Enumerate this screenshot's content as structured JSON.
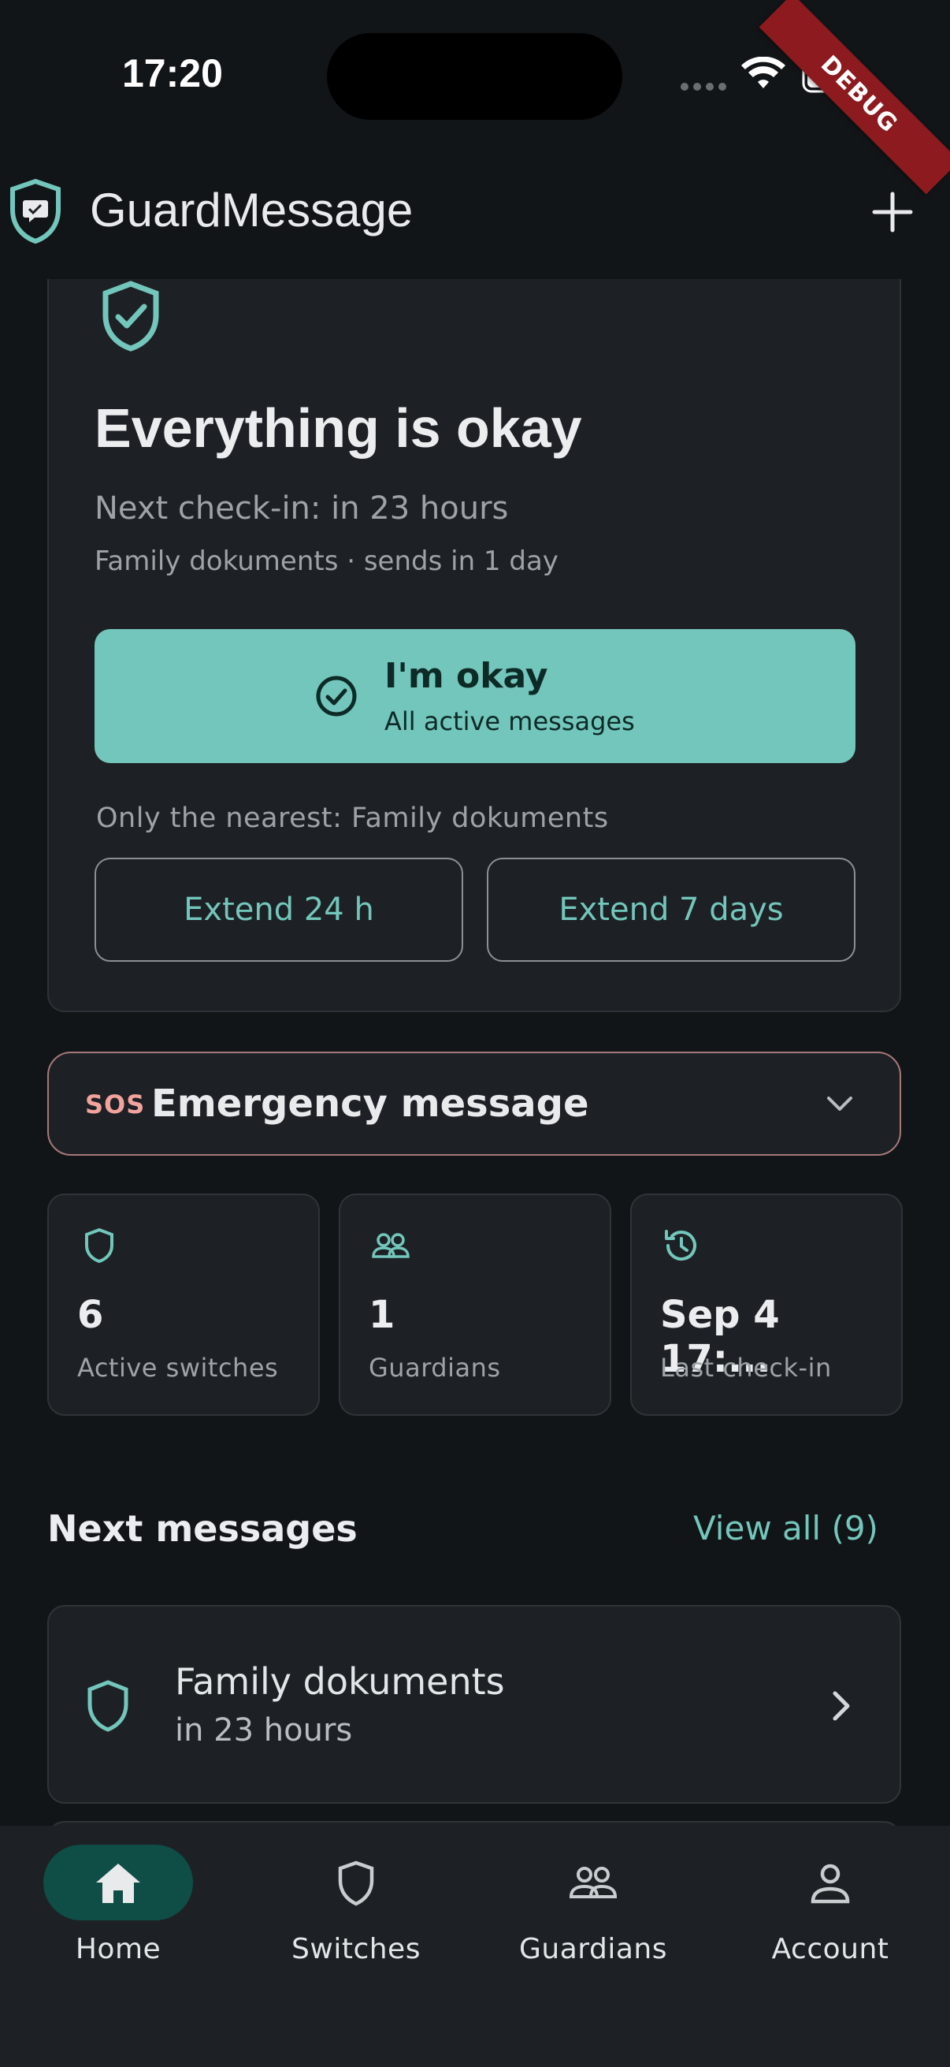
{
  "status_bar": {
    "time": "17:20"
  },
  "debug_banner": "DEBUG",
  "app_bar": {
    "title": "GuardMessage",
    "add_icon": "plus-icon"
  },
  "status_card": {
    "icon": "shield-check-icon",
    "title": "Everything is okay",
    "next_checkin": "Next check-in: in 23 hours",
    "message_line": "Family dokuments · sends in 1 day",
    "okay_button": {
      "label": "I'm okay",
      "sub": "All active messages"
    },
    "nearest_label": "Only the nearest: Family dokuments",
    "extend_24": "Extend 24 h",
    "extend_7": "Extend 7 days"
  },
  "emergency": {
    "icon_text": "SOS",
    "label": "Emergency message"
  },
  "stats": [
    {
      "icon": "shield-icon",
      "value": "6",
      "label": "Active switches"
    },
    {
      "icon": "people-icon",
      "value": "1",
      "label": "Guardians"
    },
    {
      "icon": "history-icon",
      "value": "Sep 4 17:...",
      "label": "Last check-in"
    }
  ],
  "next_messages": {
    "title": "Next messages",
    "view_all": "View all (9)",
    "items": [
      {
        "title": "Family dokuments",
        "time": "in 23 hours"
      }
    ]
  },
  "bottom_nav": {
    "items": [
      {
        "label": "Home",
        "icon": "home-icon",
        "active": true
      },
      {
        "label": "Switches",
        "icon": "shield-icon",
        "active": false
      },
      {
        "label": "Guardians",
        "icon": "people-icon",
        "active": false
      },
      {
        "label": "Account",
        "icon": "person-icon",
        "active": false
      }
    ]
  },
  "colors": {
    "accent": "#73c6bb",
    "background": "#121518",
    "card": "#1d2125",
    "emergency_border": "#a7787a",
    "sos": "#f2a39d",
    "nav_active": "#0f4d47"
  }
}
